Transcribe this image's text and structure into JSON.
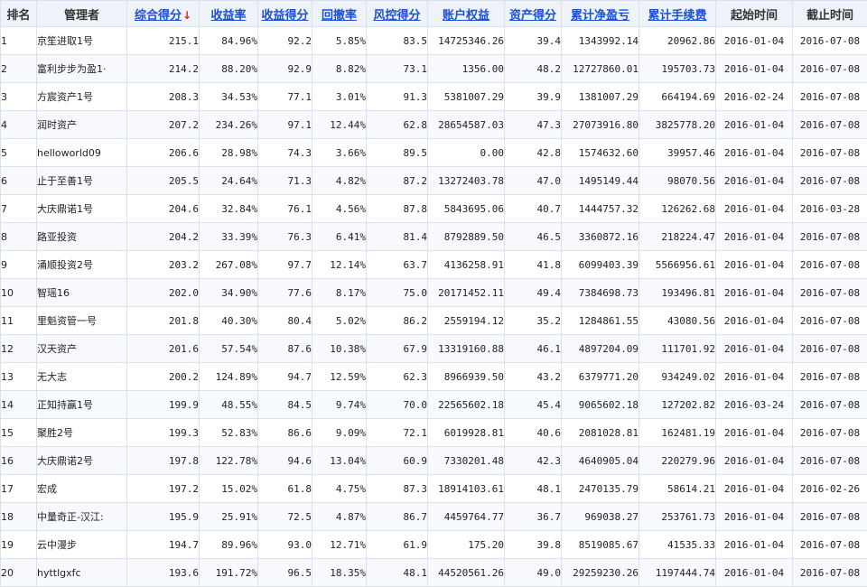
{
  "headers": {
    "rank": "排名",
    "manager": "管理者",
    "composite": "综合得分",
    "sort_arrow": "↓",
    "return_rate": "收益率",
    "return_score": "收益得分",
    "drawdown": "回撤率",
    "risk_score": "风控得分",
    "equity": "账户权益",
    "asset_score": "资产得分",
    "cum_net_profit": "累计净盈亏",
    "cum_fee": "累计手续费",
    "start": "起始时间",
    "end": "截止时间"
  },
  "colors": {
    "link_header": "#1a4fd6",
    "profit_red": "#d61f1f",
    "sort_arrow": "#e02020",
    "header_bg": "#eef3f9",
    "grid": "#d9e2ec"
  },
  "rows": [
    {
      "rank": "1",
      "name": "京笙进取1号",
      "composite": "215.1",
      "return_rate": "84.96%",
      "return_score": "92.2",
      "drawdown": "5.85%",
      "risk_score": "83.5",
      "equity": "14725346.26",
      "asset_score": "39.4",
      "cum_net_profit": "1343992.14",
      "cum_fee": "20962.86",
      "start": "2016-01-04",
      "end": "2016-07-08"
    },
    {
      "rank": "2",
      "name": "富利步步为盈1·",
      "composite": "214.2",
      "return_rate": "88.20%",
      "return_score": "92.9",
      "drawdown": "8.82%",
      "risk_score": "73.1",
      "equity": "1356.00",
      "asset_score": "48.2",
      "cum_net_profit": "12727860.01",
      "cum_fee": "195703.73",
      "start": "2016-01-04",
      "end": "2016-07-08"
    },
    {
      "rank": "3",
      "name": "方宸资产1号",
      "composite": "208.3",
      "return_rate": "34.53%",
      "return_score": "77.1",
      "drawdown": "3.01%",
      "risk_score": "91.3",
      "equity": "5381007.29",
      "asset_score": "39.9",
      "cum_net_profit": "1381007.29",
      "cum_fee": "664194.69",
      "start": "2016-02-24",
      "end": "2016-07-08"
    },
    {
      "rank": "4",
      "name": "润时资产",
      "composite": "207.2",
      "return_rate": "234.26%",
      "return_score": "97.1",
      "drawdown": "12.44%",
      "risk_score": "62.8",
      "equity": "28654587.03",
      "asset_score": "47.3",
      "cum_net_profit": "27073916.80",
      "cum_fee": "3825778.20",
      "start": "2016-01-04",
      "end": "2016-07-08"
    },
    {
      "rank": "5",
      "name": "helloworld09",
      "composite": "206.6",
      "return_rate": "28.98%",
      "return_score": "74.3",
      "drawdown": "3.66%",
      "risk_score": "89.5",
      "equity": "0.00",
      "asset_score": "42.8",
      "cum_net_profit": "1574632.60",
      "cum_fee": "39957.46",
      "start": "2016-01-04",
      "end": "2016-07-08"
    },
    {
      "rank": "6",
      "name": "止于至善1号",
      "composite": "205.5",
      "return_rate": "24.64%",
      "return_score": "71.3",
      "drawdown": "4.82%",
      "risk_score": "87.2",
      "equity": "13272403.78",
      "asset_score": "47.0",
      "cum_net_profit": "1495149.44",
      "cum_fee": "98070.56",
      "start": "2016-01-04",
      "end": "2016-07-08"
    },
    {
      "rank": "7",
      "name": "大庆鼎诺1号",
      "composite": "204.6",
      "return_rate": "32.84%",
      "return_score": "76.1",
      "drawdown": "4.56%",
      "risk_score": "87.8",
      "equity": "5843695.06",
      "asset_score": "40.7",
      "cum_net_profit": "1444757.32",
      "cum_fee": "126262.68",
      "start": "2016-01-04",
      "end": "2016-03-28"
    },
    {
      "rank": "8",
      "name": "路亚投资",
      "composite": "204.2",
      "return_rate": "33.39%",
      "return_score": "76.3",
      "drawdown": "6.41%",
      "risk_score": "81.4",
      "equity": "8792889.50",
      "asset_score": "46.5",
      "cum_net_profit": "3360872.16",
      "cum_fee": "218224.47",
      "start": "2016-01-04",
      "end": "2016-07-08"
    },
    {
      "rank": "9",
      "name": "涌顺投资2号",
      "composite": "203.2",
      "return_rate": "267.08%",
      "return_score": "97.7",
      "drawdown": "12.14%",
      "risk_score": "63.7",
      "equity": "4136258.91",
      "asset_score": "41.8",
      "cum_net_profit": "6099403.39",
      "cum_fee": "5566956.61",
      "start": "2016-01-04",
      "end": "2016-07-08"
    },
    {
      "rank": "10",
      "name": "智瑶16",
      "composite": "202.0",
      "return_rate": "34.90%",
      "return_score": "77.6",
      "drawdown": "8.17%",
      "risk_score": "75.0",
      "equity": "20171452.11",
      "asset_score": "49.4",
      "cum_net_profit": "7384698.73",
      "cum_fee": "193496.81",
      "start": "2016-01-04",
      "end": "2016-07-08"
    },
    {
      "rank": "11",
      "name": "里魁资管一号",
      "composite": "201.8",
      "return_rate": "40.30%",
      "return_score": "80.4",
      "drawdown": "5.02%",
      "risk_score": "86.2",
      "equity": "2559194.12",
      "asset_score": "35.2",
      "cum_net_profit": "1284861.55",
      "cum_fee": "43080.56",
      "start": "2016-01-04",
      "end": "2016-07-08"
    },
    {
      "rank": "12",
      "name": "汉天资产",
      "composite": "201.6",
      "return_rate": "57.54%",
      "return_score": "87.6",
      "drawdown": "10.38%",
      "risk_score": "67.9",
      "equity": "13319160.88",
      "asset_score": "46.1",
      "cum_net_profit": "4897204.09",
      "cum_fee": "111701.92",
      "start": "2016-01-04",
      "end": "2016-07-08"
    },
    {
      "rank": "13",
      "name": "无大志",
      "composite": "200.2",
      "return_rate": "124.89%",
      "return_score": "94.7",
      "drawdown": "12.59%",
      "risk_score": "62.3",
      "equity": "8966939.50",
      "asset_score": "43.2",
      "cum_net_profit": "6379771.20",
      "cum_fee": "934249.02",
      "start": "2016-01-04",
      "end": "2016-07-08"
    },
    {
      "rank": "14",
      "name": "正知持赢1号",
      "composite": "199.9",
      "return_rate": "48.55%",
      "return_score": "84.5",
      "drawdown": "9.74%",
      "risk_score": "70.0",
      "equity": "22565602.18",
      "asset_score": "45.4",
      "cum_net_profit": "9065602.18",
      "cum_fee": "127202.82",
      "start": "2016-03-24",
      "end": "2016-07-08"
    },
    {
      "rank": "15",
      "name": "聚胜2号",
      "composite": "199.3",
      "return_rate": "52.83%",
      "return_score": "86.6",
      "drawdown": "9.09%",
      "risk_score": "72.1",
      "equity": "6019928.81",
      "asset_score": "40.6",
      "cum_net_profit": "2081028.81",
      "cum_fee": "162481.19",
      "start": "2016-01-04",
      "end": "2016-07-08"
    },
    {
      "rank": "16",
      "name": "大庆鼎诺2号",
      "composite": "197.8",
      "return_rate": "122.78%",
      "return_score": "94.6",
      "drawdown": "13.04%",
      "risk_score": "60.9",
      "equity": "7330201.48",
      "asset_score": "42.3",
      "cum_net_profit": "4640905.04",
      "cum_fee": "220279.96",
      "start": "2016-01-04",
      "end": "2016-07-08"
    },
    {
      "rank": "17",
      "name": "宏成",
      "composite": "197.2",
      "return_rate": "15.02%",
      "return_score": "61.8",
      "drawdown": "4.75%",
      "risk_score": "87.3",
      "equity": "18914103.61",
      "asset_score": "48.1",
      "cum_net_profit": "2470135.79",
      "cum_fee": "58614.21",
      "start": "2016-01-04",
      "end": "2016-02-26"
    },
    {
      "rank": "18",
      "name": "中量奇正-汉江:",
      "composite": "195.9",
      "return_rate": "25.91%",
      "return_score": "72.5",
      "drawdown": "4.87%",
      "risk_score": "86.7",
      "equity": "4459764.77",
      "asset_score": "36.7",
      "cum_net_profit": "969038.27",
      "cum_fee": "253761.73",
      "start": "2016-01-04",
      "end": "2016-07-08"
    },
    {
      "rank": "19",
      "name": "云中漫步",
      "composite": "194.7",
      "return_rate": "89.96%",
      "return_score": "93.0",
      "drawdown": "12.71%",
      "risk_score": "61.9",
      "equity": "175.20",
      "asset_score": "39.8",
      "cum_net_profit": "8519085.67",
      "cum_fee": "41535.33",
      "start": "2016-01-04",
      "end": "2016-07-08"
    },
    {
      "rank": "20",
      "name": "hyttlgxfc",
      "composite": "193.6",
      "return_rate": "191.72%",
      "return_score": "96.5",
      "drawdown": "18.35%",
      "risk_score": "48.1",
      "equity": "44520561.26",
      "asset_score": "49.0",
      "cum_net_profit": "29259230.26",
      "cum_fee": "1197444.74",
      "start": "2016-01-04",
      "end": "2016-07-08"
    }
  ]
}
